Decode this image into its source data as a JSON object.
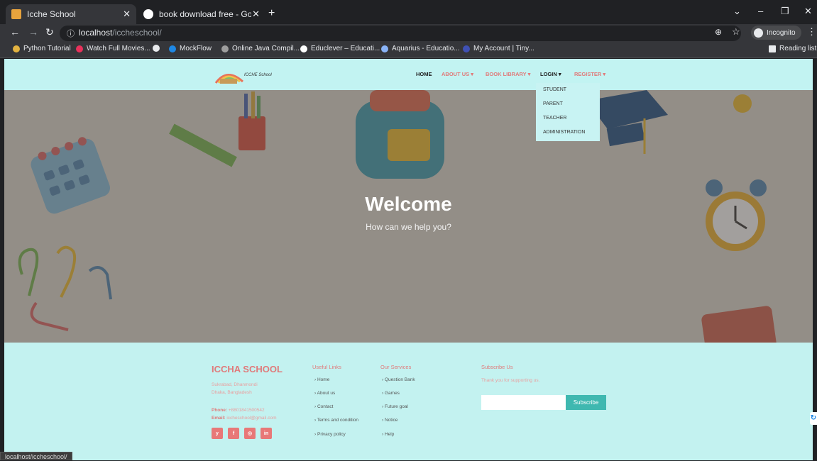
{
  "browser": {
    "tabs": [
      {
        "title": "Icche School"
      },
      {
        "title": "book download free - Google Se"
      }
    ],
    "new_tab": "+",
    "url_host": "localhost",
    "url_path": "/iccheschool/",
    "incognito_label": "Incognito",
    "reading_list": "Reading list",
    "bookmarks": [
      {
        "label": "Python Tutorial",
        "color": "#e3b341"
      },
      {
        "label": "Watch Full Movies...",
        "color": "#e8315b"
      },
      {
        "label": "MockFlow",
        "color": "#1e88e5"
      },
      {
        "label": "Online Java Compil...",
        "color": "#9e9e9e"
      },
      {
        "label": "Educlever – Educati...",
        "color": "#ffffff"
      },
      {
        "label": "Aquarius - Educatio...",
        "color": "#8ab4f8"
      },
      {
        "label": "My Account | Tiny...",
        "color": "#3f51b5"
      }
    ],
    "status_url": "localhost/iccheschool/"
  },
  "site": {
    "logo_text": "ICCHE School",
    "nav": {
      "home": "HOME",
      "about": "ABOUT US ▾",
      "library": "BOOK LIBRARY ▾",
      "login": "LOGIN ▾",
      "register": "REGISTER ▾"
    },
    "login_menu": [
      "STUDENT",
      "PARENT",
      "TEACHER",
      "ADMINISTRATION"
    ],
    "hero": {
      "title": "Welcome",
      "subtitle": "How can we help you?"
    },
    "footer": {
      "brand": "ICCHA SCHOOL",
      "address1": "Sukrabad, Dhanmondi",
      "address2": "Dhaka, Bangladesh",
      "phone_label": "Phone:",
      "phone": "+8801841500542",
      "email_label": "Email:",
      "email": "iccheschool@gmail.com",
      "social": [
        "y",
        "f",
        "◎",
        "in"
      ],
      "useful_links_title": "Useful Links",
      "useful_links": [
        "Home",
        "About us",
        "Contact",
        "Terms and condition",
        "Privacy policy"
      ],
      "services_title": "Our Services",
      "services": [
        "Question Bank",
        "Games",
        "Future goal",
        "Notice",
        "Help"
      ],
      "subscribe_title": "Subscribe Us",
      "subscribe_text": "Thank you for supporting us.",
      "subscribe_button": "Subscribe"
    }
  },
  "colors": {
    "accent": "#e07a7a",
    "page_bg": "#c4f1f1",
    "button": "#3fb8b0"
  }
}
